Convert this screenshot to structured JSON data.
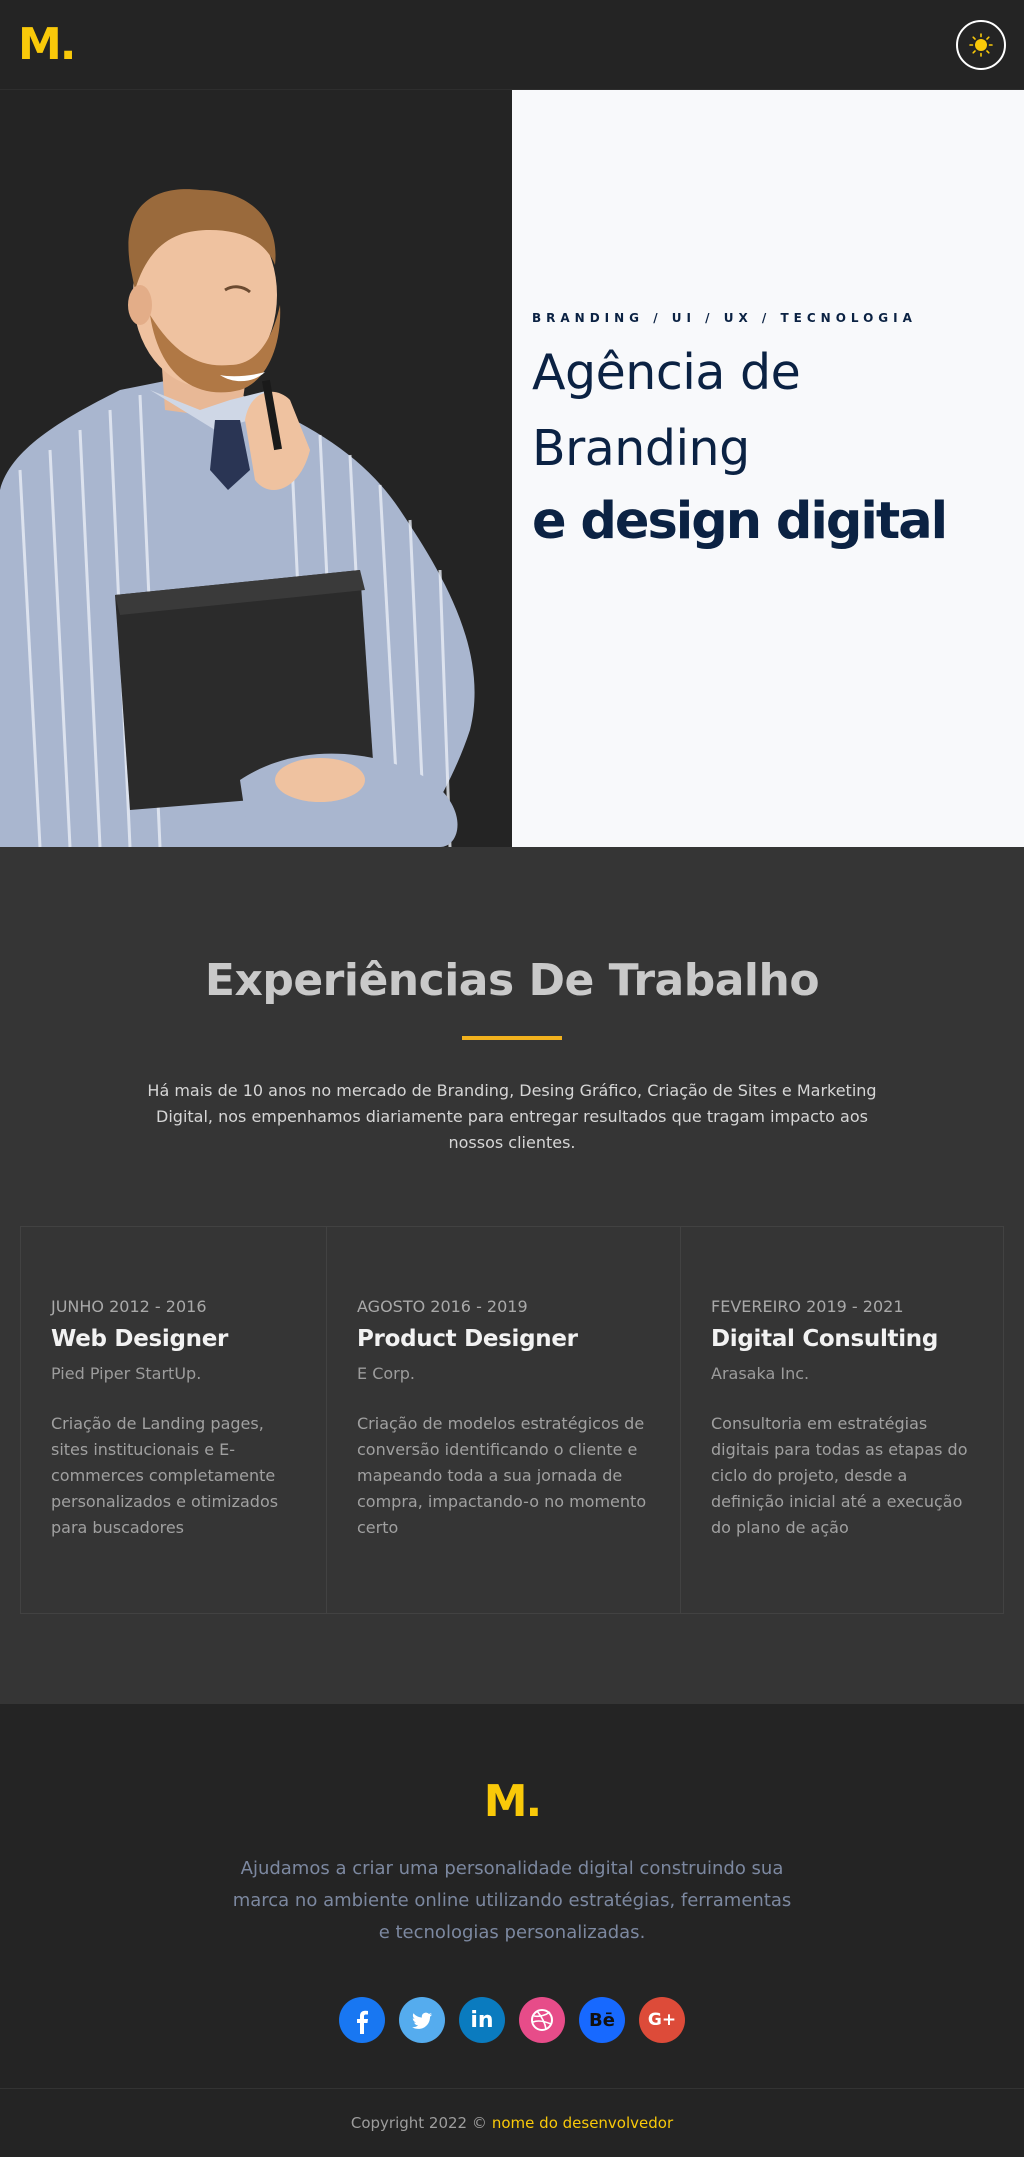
{
  "header": {
    "logo": "M."
  },
  "hero": {
    "tagline": "BRANDING / UI / UX / TECNOLOGIA",
    "title_line1": "Agência de",
    "title_line2": "Branding",
    "title_line3": "e design digital"
  },
  "experience": {
    "title": "Experiências De Trabalho",
    "intro": "Há mais de 10 anos no mercado de Branding, Desing Gráfico, Criação de Sites e Marketing Digital, nos empenhamos diariamente para entregar resultados que tragam impacto aos nossos clientes.",
    "jobs": [
      {
        "date": "JUNHO 2012 - 2016",
        "role": "Web Designer",
        "company": "Pied Piper StartUp.",
        "description": "Criação de Landing pages, sites institucionais e E-commerces completamente personalizados e otimizados para buscadores"
      },
      {
        "date": "AGOSTO 2016 - 2019",
        "role": "Product Designer",
        "company": "E Corp.",
        "description": "Criação de modelos estratégicos de conversão identificando o cliente e mapeando toda a sua jornada de compra, impactando-o no momento certo"
      },
      {
        "date": "FEVEREIRO 2019 - 2021",
        "role": "Digital Consulting",
        "company": "Arasaka Inc.",
        "description": "Consultoria em estratégias digitais para todas as etapas do ciclo do projeto, desde a definição inicial até a execução do plano de ação"
      }
    ]
  },
  "footer": {
    "logo": "M.",
    "text": "Ajudamos a criar uma personalidade digital construindo sua marca no ambiente online utilizando estratégias, ferramentas e tecnologias personalizadas.",
    "socials": [
      {
        "name": "facebook-icon",
        "color": "#1877f2"
      },
      {
        "name": "twitter-icon",
        "color": "#55acee"
      },
      {
        "name": "linkedin-icon",
        "color": "#0a7bbf",
        "label": "in"
      },
      {
        "name": "dribbble-icon",
        "color": "#e74c89"
      },
      {
        "name": "behance-icon",
        "color": "#1769ff",
        "label": "Bē"
      },
      {
        "name": "google-plus-icon",
        "color": "#dd4b39",
        "label": "G+"
      }
    ]
  },
  "copyright": {
    "text": "Copyright 2022 ©",
    "developer": "nome do desenvolvedor"
  },
  "colors": {
    "accent": "#f9c909",
    "navy": "#0b2243",
    "dark": "#242424",
    "section": "#353535"
  }
}
